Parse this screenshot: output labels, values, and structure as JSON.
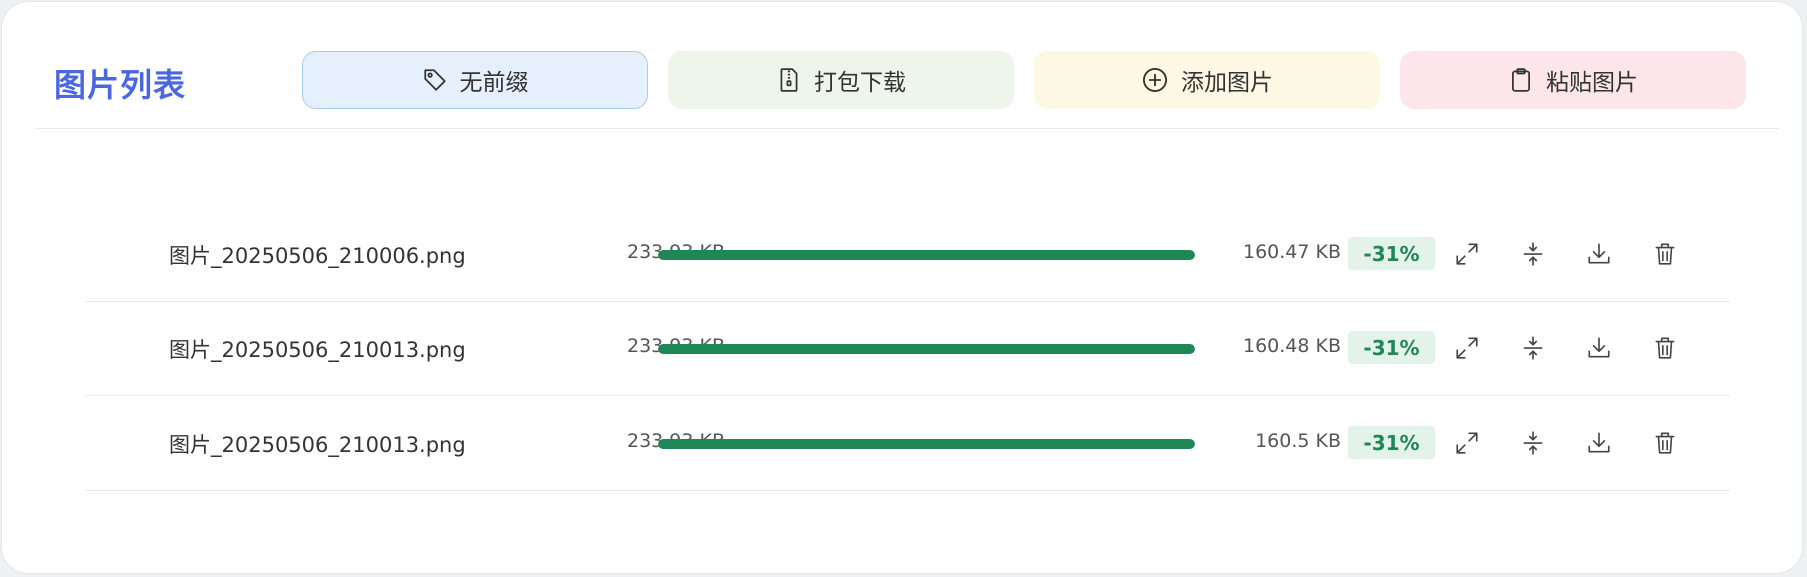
{
  "header": {
    "title": "图片列表",
    "buttons": {
      "prefix": {
        "label": "无前缀",
        "icon": "tag-icon"
      },
      "zip": {
        "label": "打包下载",
        "icon": "zip-file-icon"
      },
      "add": {
        "label": "添加图片",
        "icon": "plus-circle-icon"
      },
      "paste": {
        "label": "粘贴图片",
        "icon": "clipboard-icon"
      }
    }
  },
  "colors": {
    "accent": "#4a67e0",
    "success": "#1e8755",
    "badge_bg": "#e3f3ea"
  },
  "files": [
    {
      "name": "图片_20250506_210006.png",
      "original_size": "233.93 KB",
      "progress_percent": 100,
      "compressed_size": "160.47 KB",
      "ratio": "-31%"
    },
    {
      "name": "图片_20250506_210013.png",
      "original_size": "233.93 KB",
      "progress_percent": 100,
      "compressed_size": "160.48 KB",
      "ratio": "-31%"
    },
    {
      "name": "图片_20250506_210013.png",
      "original_size": "233.93 KB",
      "progress_percent": 100,
      "compressed_size": "160.5 KB",
      "ratio": "-31%"
    }
  ],
  "row_action_icons": [
    "expand-icon",
    "compress-icon",
    "download-icon",
    "trash-icon"
  ]
}
